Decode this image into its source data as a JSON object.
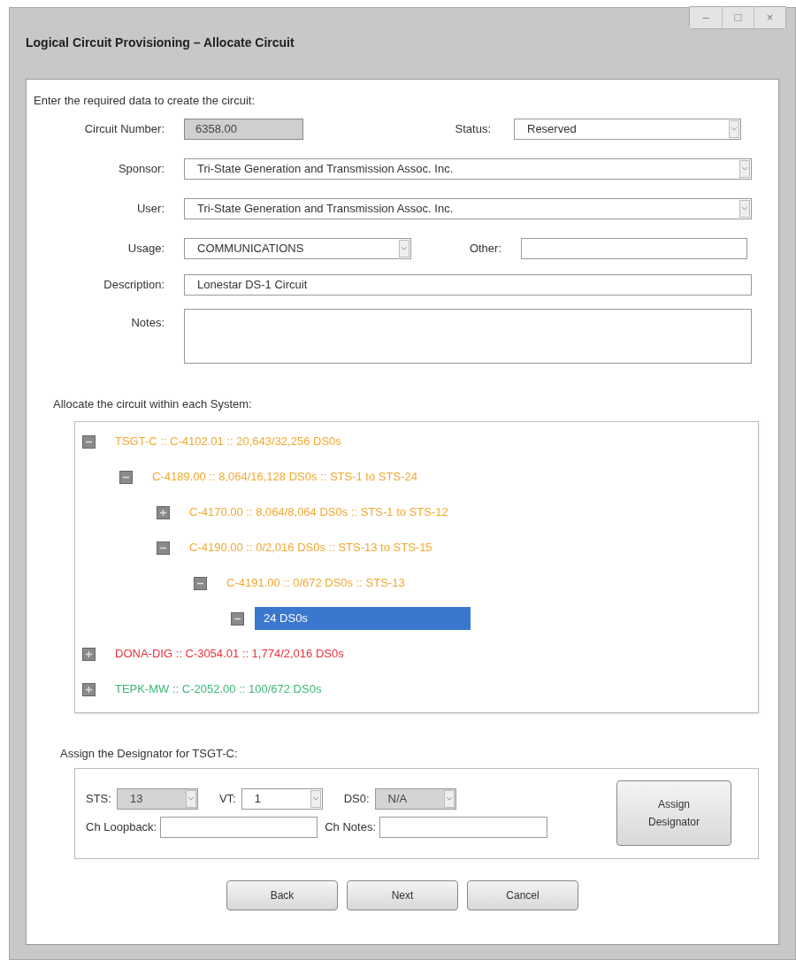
{
  "window": {
    "title": "Logical Circuit Provisioning – Allocate Circuit",
    "controls": [
      "–",
      "□",
      "×"
    ]
  },
  "intro": "Enter the required data to create the circuit:",
  "circuit_number": {
    "label": "Circuit Number:",
    "value": "6358.00",
    "disabled": true
  },
  "status": {
    "label": "Status:",
    "value": "Reserved"
  },
  "sponsor": {
    "label": "Sponsor:",
    "value": "Tri-State Generation and Transmission Assoc. Inc."
  },
  "user": {
    "label": "User:",
    "value": "Tri-State Generation and Transmission Assoc. Inc."
  },
  "usage": {
    "label": "Usage:",
    "value": "COMMUNICATIONS"
  },
  "other": {
    "label": "Other:"
  },
  "description": {
    "label": "Description:",
    "value": "Lonestar DS-1 Circuit"
  },
  "notes": {
    "label": "Notes:"
  },
  "allocate_label": "Allocate the circuit within each System:",
  "tree": [
    {
      "label": "TSGT-C :: C-4102.01 :: 20,643/32,256 DS0s",
      "color": "#f0a830",
      "expanded": true,
      "selected": false,
      "children": [
        {
          "label": "C-4189.00 :: 8,064/16,128 DS0s :: STS-1 to STS-24",
          "color": "#f0a830",
          "expanded": true,
          "selected": false,
          "children": [
            {
              "label": "C-4170.00 :: 8,064/8,064 DS0s :: STS-1 to STS-12",
              "color": "#f0a830",
              "expanded": false,
              "selected": false
            },
            {
              "label": "C-4190.00 :: 0/2,016 DS0s :: STS-13 to STS-15",
              "color": "#f0a830",
              "expanded": true,
              "selected": false,
              "children": [
                {
                  "label": "C-4191.00 :: 0/672 DS0s :: STS-13",
                  "color": "#f0a830",
                  "expanded": true,
                  "selected": false,
                  "children": [
                    {
                      "label": "24 DS0s",
                      "expanded": true,
                      "selected": true
                    }
                  ]
                }
              ]
            }
          ]
        }
      ]
    },
    {
      "label": "DONA-DIG :: C-3054.01 :: 1,774/2,016 DS0s",
      "color": "#e8303c",
      "expanded": false,
      "selected": false
    },
    {
      "label": "TEPK-MW :: C-2052.00 :: 100/672 DS0s",
      "color": "#3cb878",
      "expanded": false,
      "selected": false
    }
  ],
  "designator_label": "Assign the Designator for TSGT-C:",
  "sts": {
    "label": "STS:",
    "value": "13",
    "disabled": true
  },
  "vt": {
    "label": "VT:",
    "value": "1",
    "disabled": false
  },
  "ds0": {
    "label": "DS0:",
    "value": "N/A",
    "disabled": true
  },
  "ch_loopback": {
    "label": "Ch Loopback:"
  },
  "ch_notes": {
    "label": "Ch Notes:"
  },
  "assign_button": "Assign Designator",
  "buttons": [
    "Back",
    "Next",
    "Cancel"
  ]
}
